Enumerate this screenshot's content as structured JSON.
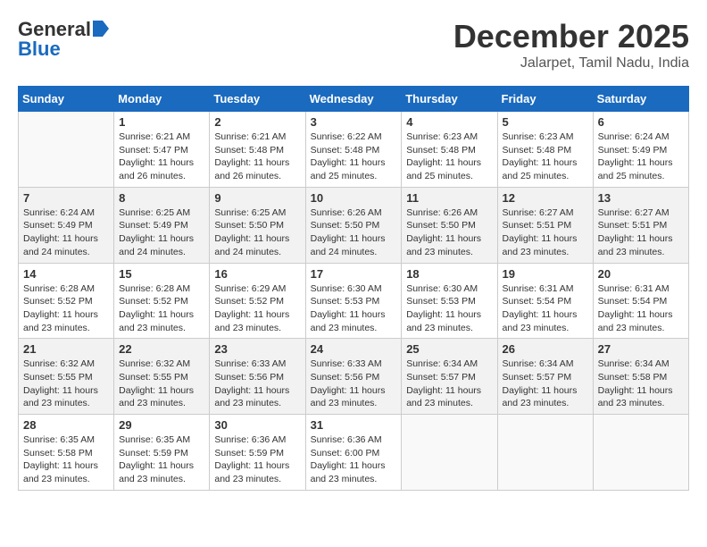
{
  "logo": {
    "line1": "General",
    "line2": "Blue"
  },
  "title": "December 2025",
  "subtitle": "Jalarpet, Tamil Nadu, India",
  "weekdays": [
    "Sunday",
    "Monday",
    "Tuesday",
    "Wednesday",
    "Thursday",
    "Friday",
    "Saturday"
  ],
  "weeks": [
    [
      {
        "day": "",
        "sunrise": "",
        "sunset": "",
        "daylight": ""
      },
      {
        "day": "1",
        "sunrise": "Sunrise: 6:21 AM",
        "sunset": "Sunset: 5:47 PM",
        "daylight": "Daylight: 11 hours and 26 minutes."
      },
      {
        "day": "2",
        "sunrise": "Sunrise: 6:21 AM",
        "sunset": "Sunset: 5:48 PM",
        "daylight": "Daylight: 11 hours and 26 minutes."
      },
      {
        "day": "3",
        "sunrise": "Sunrise: 6:22 AM",
        "sunset": "Sunset: 5:48 PM",
        "daylight": "Daylight: 11 hours and 25 minutes."
      },
      {
        "day": "4",
        "sunrise": "Sunrise: 6:23 AM",
        "sunset": "Sunset: 5:48 PM",
        "daylight": "Daylight: 11 hours and 25 minutes."
      },
      {
        "day": "5",
        "sunrise": "Sunrise: 6:23 AM",
        "sunset": "Sunset: 5:48 PM",
        "daylight": "Daylight: 11 hours and 25 minutes."
      },
      {
        "day": "6",
        "sunrise": "Sunrise: 6:24 AM",
        "sunset": "Sunset: 5:49 PM",
        "daylight": "Daylight: 11 hours and 25 minutes."
      }
    ],
    [
      {
        "day": "7",
        "sunrise": "Sunrise: 6:24 AM",
        "sunset": "Sunset: 5:49 PM",
        "daylight": "Daylight: 11 hours and 24 minutes."
      },
      {
        "day": "8",
        "sunrise": "Sunrise: 6:25 AM",
        "sunset": "Sunset: 5:49 PM",
        "daylight": "Daylight: 11 hours and 24 minutes."
      },
      {
        "day": "9",
        "sunrise": "Sunrise: 6:25 AM",
        "sunset": "Sunset: 5:50 PM",
        "daylight": "Daylight: 11 hours and 24 minutes."
      },
      {
        "day": "10",
        "sunrise": "Sunrise: 6:26 AM",
        "sunset": "Sunset: 5:50 PM",
        "daylight": "Daylight: 11 hours and 24 minutes."
      },
      {
        "day": "11",
        "sunrise": "Sunrise: 6:26 AM",
        "sunset": "Sunset: 5:50 PM",
        "daylight": "Daylight: 11 hours and 23 minutes."
      },
      {
        "day": "12",
        "sunrise": "Sunrise: 6:27 AM",
        "sunset": "Sunset: 5:51 PM",
        "daylight": "Daylight: 11 hours and 23 minutes."
      },
      {
        "day": "13",
        "sunrise": "Sunrise: 6:27 AM",
        "sunset": "Sunset: 5:51 PM",
        "daylight": "Daylight: 11 hours and 23 minutes."
      }
    ],
    [
      {
        "day": "14",
        "sunrise": "Sunrise: 6:28 AM",
        "sunset": "Sunset: 5:52 PM",
        "daylight": "Daylight: 11 hours and 23 minutes."
      },
      {
        "day": "15",
        "sunrise": "Sunrise: 6:28 AM",
        "sunset": "Sunset: 5:52 PM",
        "daylight": "Daylight: 11 hours and 23 minutes."
      },
      {
        "day": "16",
        "sunrise": "Sunrise: 6:29 AM",
        "sunset": "Sunset: 5:52 PM",
        "daylight": "Daylight: 11 hours and 23 minutes."
      },
      {
        "day": "17",
        "sunrise": "Sunrise: 6:30 AM",
        "sunset": "Sunset: 5:53 PM",
        "daylight": "Daylight: 11 hours and 23 minutes."
      },
      {
        "day": "18",
        "sunrise": "Sunrise: 6:30 AM",
        "sunset": "Sunset: 5:53 PM",
        "daylight": "Daylight: 11 hours and 23 minutes."
      },
      {
        "day": "19",
        "sunrise": "Sunrise: 6:31 AM",
        "sunset": "Sunset: 5:54 PM",
        "daylight": "Daylight: 11 hours and 23 minutes."
      },
      {
        "day": "20",
        "sunrise": "Sunrise: 6:31 AM",
        "sunset": "Sunset: 5:54 PM",
        "daylight": "Daylight: 11 hours and 23 minutes."
      }
    ],
    [
      {
        "day": "21",
        "sunrise": "Sunrise: 6:32 AM",
        "sunset": "Sunset: 5:55 PM",
        "daylight": "Daylight: 11 hours and 23 minutes."
      },
      {
        "day": "22",
        "sunrise": "Sunrise: 6:32 AM",
        "sunset": "Sunset: 5:55 PM",
        "daylight": "Daylight: 11 hours and 23 minutes."
      },
      {
        "day": "23",
        "sunrise": "Sunrise: 6:33 AM",
        "sunset": "Sunset: 5:56 PM",
        "daylight": "Daylight: 11 hours and 23 minutes."
      },
      {
        "day": "24",
        "sunrise": "Sunrise: 6:33 AM",
        "sunset": "Sunset: 5:56 PM",
        "daylight": "Daylight: 11 hours and 23 minutes."
      },
      {
        "day": "25",
        "sunrise": "Sunrise: 6:34 AM",
        "sunset": "Sunset: 5:57 PM",
        "daylight": "Daylight: 11 hours and 23 minutes."
      },
      {
        "day": "26",
        "sunrise": "Sunrise: 6:34 AM",
        "sunset": "Sunset: 5:57 PM",
        "daylight": "Daylight: 11 hours and 23 minutes."
      },
      {
        "day": "27",
        "sunrise": "Sunrise: 6:34 AM",
        "sunset": "Sunset: 5:58 PM",
        "daylight": "Daylight: 11 hours and 23 minutes."
      }
    ],
    [
      {
        "day": "28",
        "sunrise": "Sunrise: 6:35 AM",
        "sunset": "Sunset: 5:58 PM",
        "daylight": "Daylight: 11 hours and 23 minutes."
      },
      {
        "day": "29",
        "sunrise": "Sunrise: 6:35 AM",
        "sunset": "Sunset: 5:59 PM",
        "daylight": "Daylight: 11 hours and 23 minutes."
      },
      {
        "day": "30",
        "sunrise": "Sunrise: 6:36 AM",
        "sunset": "Sunset: 5:59 PM",
        "daylight": "Daylight: 11 hours and 23 minutes."
      },
      {
        "day": "31",
        "sunrise": "Sunrise: 6:36 AM",
        "sunset": "Sunset: 6:00 PM",
        "daylight": "Daylight: 11 hours and 23 minutes."
      },
      {
        "day": "",
        "sunrise": "",
        "sunset": "",
        "daylight": ""
      },
      {
        "day": "",
        "sunrise": "",
        "sunset": "",
        "daylight": ""
      },
      {
        "day": "",
        "sunrise": "",
        "sunset": "",
        "daylight": ""
      }
    ]
  ]
}
